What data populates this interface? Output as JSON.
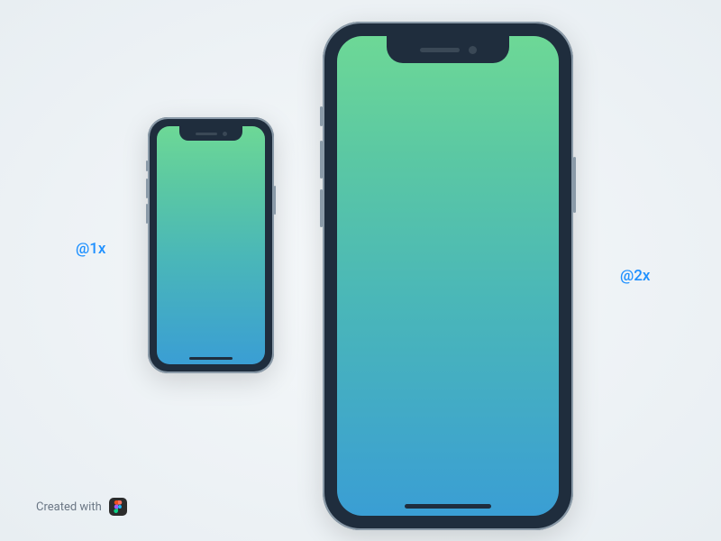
{
  "labels": {
    "scale_1x": "@1x",
    "scale_2x": "@2x"
  },
  "credit": {
    "text": "Created with",
    "tool": "figma"
  },
  "mockup": {
    "device": "iPhone X",
    "screen_gradient": [
      "#6dd896",
      "#3a9ed4"
    ],
    "frame_color": "#1f2d3d"
  }
}
